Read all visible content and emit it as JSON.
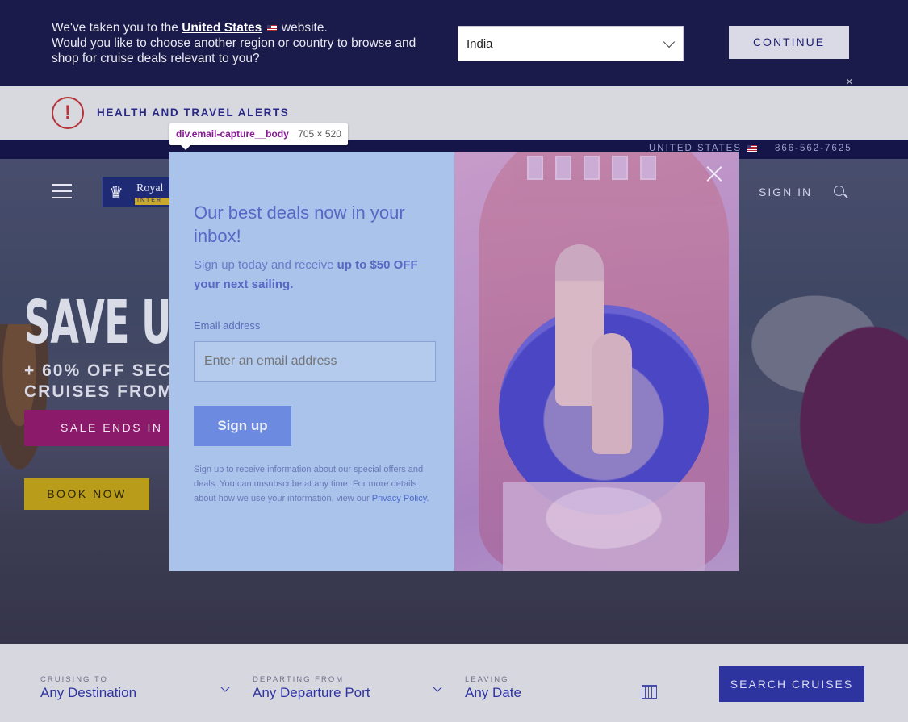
{
  "region_banner": {
    "line1_prefix": "We've taken you to the",
    "line1_link": "United States",
    "line1_suffix": "website.",
    "line2": "Would you like to choose another region or country to browse and shop for cruise deals relevant to you?",
    "selected_region": "India",
    "continue_label": "CONTINUE",
    "close_glyph": "×"
  },
  "alerts": {
    "icon_glyph": "!",
    "label": "HEALTH AND TRAVEL ALERTS"
  },
  "utility": {
    "country": "UNITED STATES",
    "phone": "866-562-7625"
  },
  "header": {
    "logo_text": "Royal",
    "logo_strip": "INTER",
    "logo_crown": "♛",
    "sign_in": "SIGN IN"
  },
  "hero": {
    "headline": "SAVE U",
    "sub_line1": "+ 60% OFF SEC",
    "sub_line2": "CRUISES FROM",
    "sale_ends": "SALE ENDS IN",
    "book_now": "BOOK NOW"
  },
  "dev_tooltip": {
    "tag": "div.email-capture__body",
    "dims": "705 × 520"
  },
  "email_modal": {
    "title": "Our best deals now in your inbox!",
    "sub_prefix": "Sign up today and receive",
    "sub_bold": "up to $50 OFF your next sailing.",
    "email_label": "Email address",
    "email_placeholder": "Enter an email address",
    "signup_label": "Sign up",
    "legal_text": "Sign up to receive information about our special offers and deals. You can unsubscribe at any time. For more details about how we use your information, view our",
    "privacy_link": "Privacy Policy."
  },
  "search": {
    "cruising_to_label": "CRUISING TO",
    "cruising_to_value": "Any Destination",
    "departing_label": "DEPARTING FROM",
    "departing_value": "Any Departure Port",
    "leaving_label": "LEAVING",
    "leaving_value": "Any Date",
    "search_label": "SEARCH CRUISES"
  },
  "colors": {
    "brand_navy": "#1a1a4b",
    "brand_blue": "#2d339f",
    "alert_red": "#b8333a",
    "sale_magenta": "#8c1a6a",
    "book_gold": "#b89c1a"
  }
}
